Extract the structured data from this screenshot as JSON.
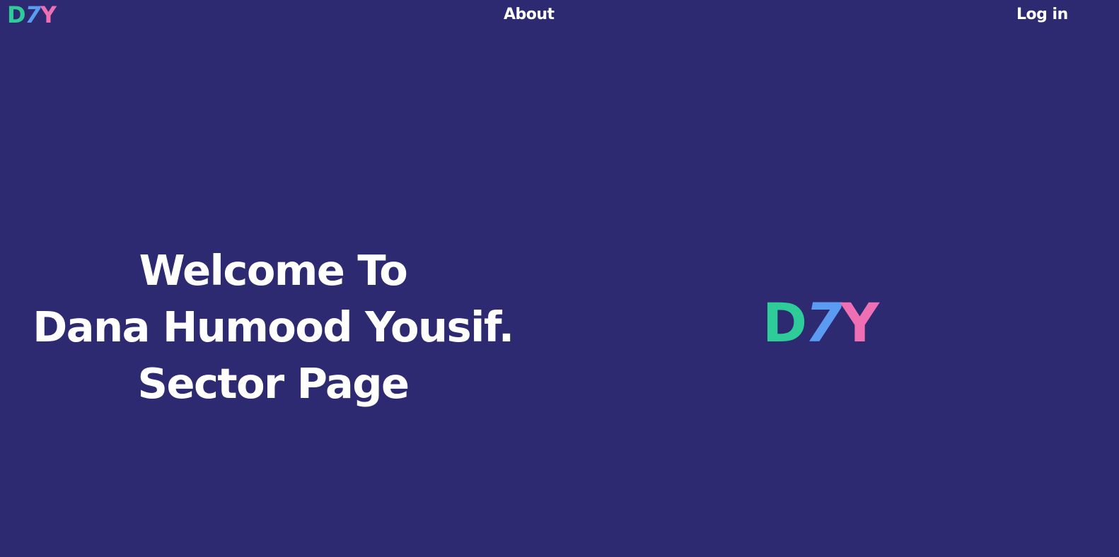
{
  "colors": {
    "background": "#2e2a72",
    "text": "#ffffff",
    "logo_d": "#2ecc98",
    "logo_7": "#5b9cf2",
    "logo_y": "#ee6fb4"
  },
  "nav": {
    "logo": {
      "d": "D",
      "seven": "7",
      "y": "Y"
    },
    "about_label": "About",
    "login_label": "Log in"
  },
  "hero": {
    "line1": "Welcome To",
    "line2": "Dana Humood Yousif.",
    "line3": "Sector Page",
    "logo": {
      "d": "D",
      "seven": "7",
      "y": "Y"
    }
  }
}
